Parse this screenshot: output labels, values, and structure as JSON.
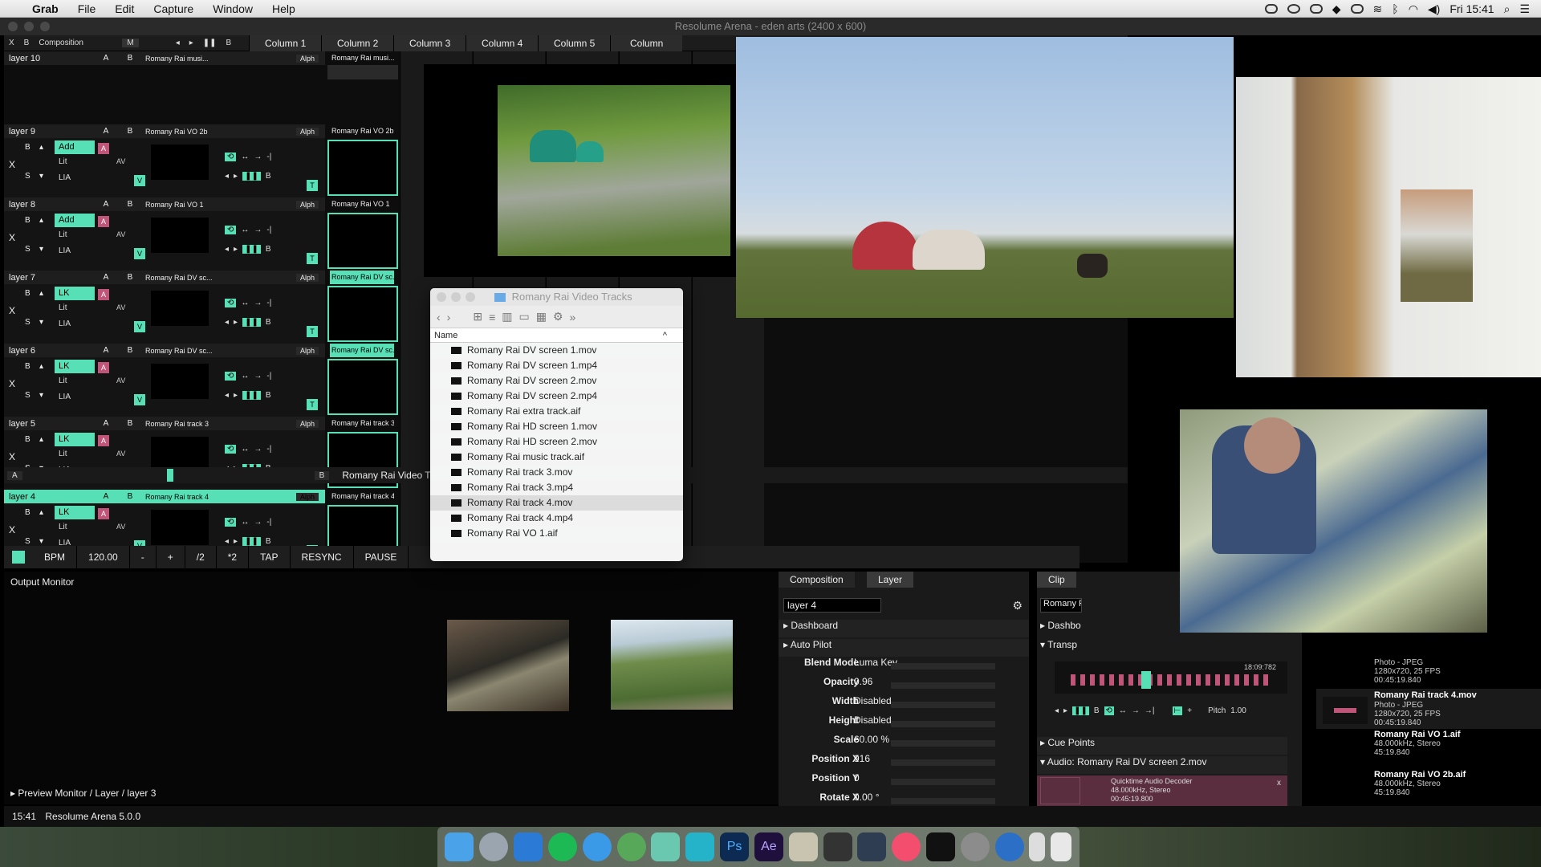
{
  "menubar": {
    "app": "Grab",
    "menus": [
      "File",
      "Edit",
      "Capture",
      "Window",
      "Help"
    ],
    "clock": "Fri 15:41"
  },
  "window": {
    "title": "Resolume Arena - eden arts (2400 x 600)"
  },
  "composition": {
    "header": {
      "x": "X",
      "b": "B",
      "label": "Composition",
      "m": "M"
    },
    "columns": [
      "Column 1",
      "Column 2",
      "Column 3",
      "Column 4",
      "Column 5",
      "Column"
    ],
    "layers": [
      {
        "name": "layer 10",
        "clip": "Romany Rai musi...",
        "slot": "Romany Rai musi..."
      },
      {
        "name": "layer 9",
        "blend": "Add",
        "clip": "Romany Rai VO 2b",
        "slot": "Romany Rai VO 2b"
      },
      {
        "name": "layer 8",
        "blend": "Add",
        "clip": "Romany Rai VO 1",
        "slot": "Romany Rai VO 1"
      },
      {
        "name": "layer 7",
        "blend": "LK",
        "clip": "Romany Rai DV sc...",
        "slot": "Romany Rai DV sc..."
      },
      {
        "name": "layer 6",
        "blend": "LK",
        "clip": "Romany Rai DV sc...",
        "slot": "Romany Rai DV sc..."
      },
      {
        "name": "layer 5",
        "blend": "LK",
        "clip": "Romany Rai track 3",
        "slot": "Romany Rai track 3"
      },
      {
        "name": "layer 4",
        "blend": "LK",
        "clip": "Romany Rai track 4",
        "slot": "Romany Rai track 4"
      }
    ],
    "layer_labels": {
      "a": "A",
      "b": "B",
      "alph": "Alph",
      "lit": "Lit",
      "lia": "LIA",
      "s": "S",
      "x": "X",
      "av": "AV",
      "v": "V",
      "t": "T"
    },
    "bottom_row": {
      "a": "A",
      "b": "B",
      "label": "Romany Rai Video Tra"
    }
  },
  "transport": {
    "bpm_label": "BPM",
    "bpm_value": "120.00",
    "buttons": [
      "-",
      "+",
      "/2",
      "*2",
      "TAP",
      "RESYNC",
      "PAUSE"
    ]
  },
  "output_monitor": {
    "title": "Output Monitor"
  },
  "preview": {
    "label": "Preview Monitor / Layer / layer 3"
  },
  "status": {
    "time": "15:41",
    "app": "Resolume Arena 5.0.0"
  },
  "properties": {
    "tabs": [
      "Composition",
      "Layer"
    ],
    "layer_name": "layer 4",
    "sections": [
      "Dashboard",
      "Auto Pilot"
    ],
    "rows": [
      {
        "label": "Blend Mode",
        "value": "Luma Key"
      },
      {
        "label": "Opacity",
        "value": "0.96"
      },
      {
        "label": "Width",
        "value": "Disabled"
      },
      {
        "label": "Height",
        "value": "Disabled"
      },
      {
        "label": "Scale",
        "value": "60.00 %"
      },
      {
        "label": "Position X",
        "value": "916"
      },
      {
        "label": "Position Y",
        "value": "0"
      },
      {
        "label": "Rotate X",
        "value": "0.00 °"
      }
    ]
  },
  "clip_panel": {
    "tab": "Clip",
    "name": "Romany F",
    "sections": [
      "Dashbo",
      "Transp",
      "Cue Points",
      "Audio: Romany Rai DV screen 2.mov"
    ],
    "timecode": "18:09:782",
    "pitch_label": "Pitch",
    "pitch_value": "1.00",
    "decoder": "Quicktime Audio Decoder",
    "audio_info": "48.000kHz, Stereo",
    "duration": "00:45:19.800"
  },
  "file_list": [
    {
      "name": "Romany Rai track 4.mov",
      "info1": "Photo - JPEG",
      "info2": "1280x720, 25 FPS",
      "info3": "00:45:19.840"
    },
    {
      "name": "Romany Rai VO 1.aif",
      "info1": "48.000kHz, Stereo",
      "info2": "45:19.840"
    },
    {
      "name": "Romany Rai VO 2b.aif",
      "info1": "48.000kHz, Stereo",
      "info2": "45:19.840"
    }
  ],
  "file_list_top": {
    "info1": "Photo - JPEG",
    "info2": "1280x720, 25 FPS",
    "info3": "00:45:19.840"
  },
  "finder": {
    "title": "Romany Rai Video Tracks",
    "column": "Name",
    "files": [
      "Romany Rai DV screen 1.mov",
      "Romany Rai DV screen 1.mp4",
      "Romany Rai DV screen 2.mov",
      "Romany Rai DV screen 2.mp4",
      "Romany Rai extra track.aif",
      "Romany Rai HD screen 1.mov",
      "Romany Rai HD screen 2.mov",
      "Romany Rai music track.aif",
      "Romany Rai track 3.mov",
      "Romany Rai track 3.mp4",
      "Romany Rai track 4.mov",
      "Romany Rai track 4.mp4",
      "Romany Rai VO 1.aif"
    ],
    "selected": "Romany Rai track 4.mov"
  },
  "colors": {
    "accent": "#57e0b5",
    "pink": "#c0557a",
    "bg": "#111111"
  }
}
